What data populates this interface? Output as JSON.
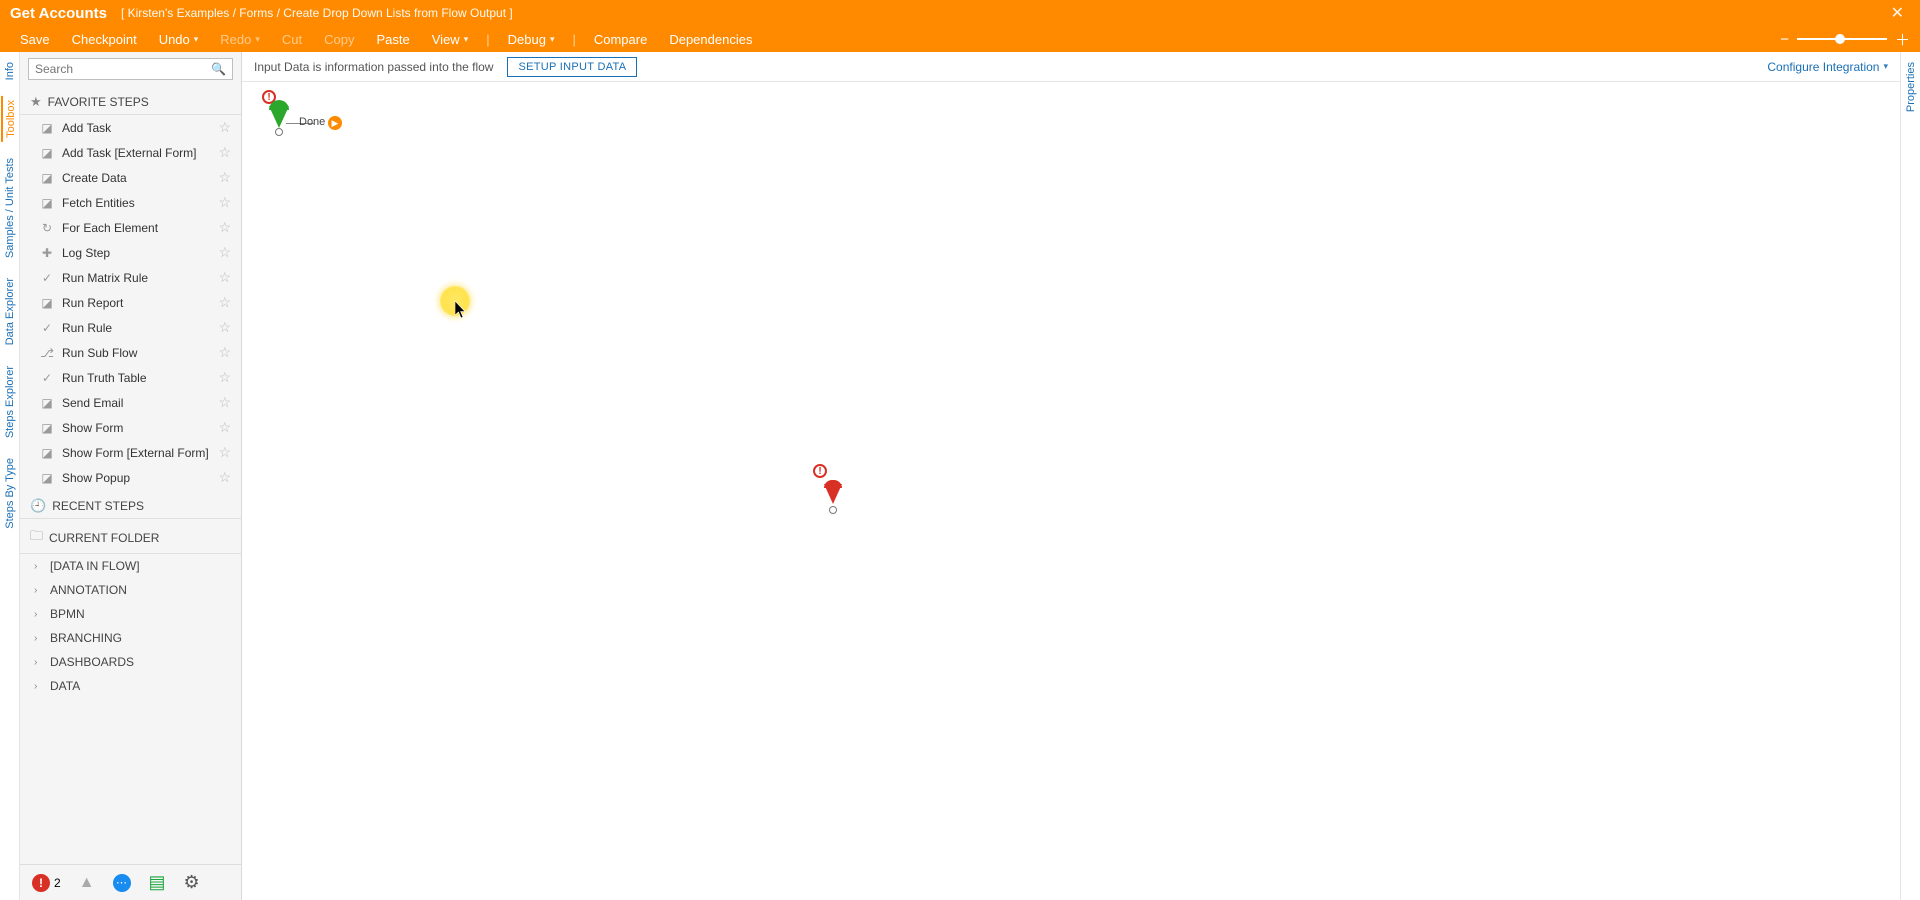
{
  "header": {
    "title": "Get Accounts",
    "breadcrumb": "[ Kirsten's Examples / Forms / Create Drop Down Lists from Flow Output ]",
    "close_glyph": "✕"
  },
  "menu": {
    "save": "Save",
    "checkpoint": "Checkpoint",
    "undo": "Undo",
    "redo": "Redo",
    "cut": "Cut",
    "copy": "Copy",
    "paste": "Paste",
    "view": "View",
    "debug": "Debug",
    "compare": "Compare",
    "dependencies": "Dependencies"
  },
  "left_tabs": {
    "info": "Info",
    "toolbox": "Toolbox",
    "samples": "Samples / Unit Tests",
    "data_explorer": "Data Explorer",
    "steps_explorer": "Steps Explorer",
    "steps_by_type": "Steps By Type"
  },
  "right_tabs": {
    "properties": "Properties"
  },
  "toolbox": {
    "search_placeholder": "Search",
    "sections": {
      "favorite": "FAVORITE STEPS",
      "recent": "RECENT STEPS",
      "current": "CURRENT FOLDER"
    },
    "favorites": [
      {
        "icon": "◪",
        "label": "Add Task"
      },
      {
        "icon": "◪",
        "label": "Add Task [External Form]"
      },
      {
        "icon": "◪",
        "label": "Create Data"
      },
      {
        "icon": "◪",
        "label": "Fetch Entities"
      },
      {
        "icon": "↻",
        "label": "For Each Element"
      },
      {
        "icon": "✚",
        "label": "Log Step"
      },
      {
        "icon": "✓",
        "label": "Run Matrix Rule"
      },
      {
        "icon": "◪",
        "label": "Run Report"
      },
      {
        "icon": "✓",
        "label": "Run Rule"
      },
      {
        "icon": "⎇",
        "label": "Run Sub Flow"
      },
      {
        "icon": "✓",
        "label": "Run Truth Table"
      },
      {
        "icon": "◪",
        "label": "Send Email"
      },
      {
        "icon": "◪",
        "label": "Show Form"
      },
      {
        "icon": "◪",
        "label": "Show Form [External Form]"
      },
      {
        "icon": "◪",
        "label": "Show Popup"
      }
    ],
    "tree": [
      "[DATA IN FLOW]",
      "ANNOTATION",
      "BPMN",
      "BRANCHING",
      "DASHBOARDS",
      "DATA"
    ]
  },
  "canvas_bar": {
    "hint": "Input Data is information passed into the flow",
    "setup": "SETUP INPUT DATA",
    "configure": "Configure Integration"
  },
  "canvas": {
    "done_label": "Done",
    "warn_glyph": "!"
  },
  "footer": {
    "error_count": "2"
  }
}
